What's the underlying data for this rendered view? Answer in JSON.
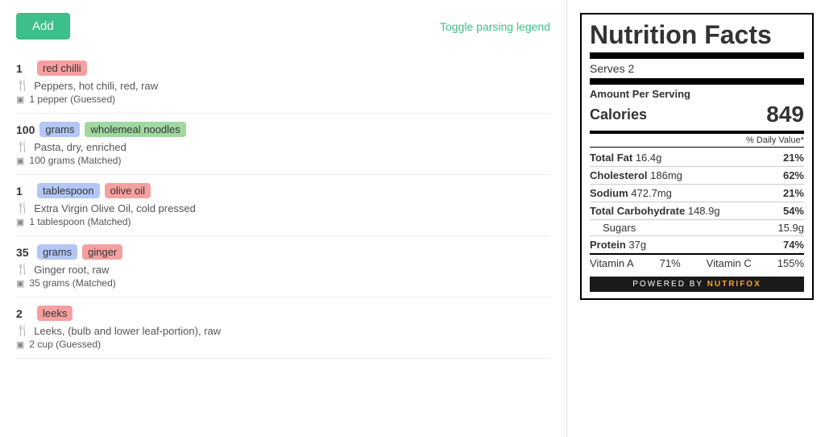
{
  "toolbar": {
    "add_label": "Add",
    "toggle_label": "Toggle parsing legend"
  },
  "ingredients": [
    {
      "qty": "1",
      "unit": null,
      "name": "red chilli",
      "name_color": "pink",
      "unit_color": null,
      "description": "Peppers, hot chili, red, raw",
      "match": "1 pepper (Guessed)"
    },
    {
      "qty": "100",
      "unit": "grams",
      "name": "wholemeal noodles",
      "name_color": "green",
      "unit_color": "blue",
      "description": "Pasta, dry, enriched",
      "match": "100 grams (Matched)"
    },
    {
      "qty": "1",
      "unit": "tablespoon",
      "name": "olive oil",
      "name_color": "pink",
      "unit_color": "blue",
      "description": "Extra Virgin Olive Oil, cold pressed",
      "match": "1 tablespoon (Matched)"
    },
    {
      "qty": "35",
      "unit": "grams",
      "name": "ginger",
      "name_color": "pink",
      "unit_color": "blue",
      "description": "Ginger root, raw",
      "match": "35 grams (Matched)"
    },
    {
      "qty": "2",
      "unit": null,
      "name": "leeks",
      "name_color": "pink",
      "unit_color": null,
      "description": "Leeks, (bulb and lower leaf-portion), raw",
      "match": "2 cup (Guessed)"
    }
  ],
  "nutrition": {
    "title": "Nutrition Facts",
    "serves": "Serves 2",
    "amount_label": "Amount Per Serving",
    "calories_label": "Calories",
    "calories_value": "849",
    "dv_header": "% Daily Value*",
    "total_fat_label": "Total Fat",
    "total_fat_value": "16.4g",
    "total_fat_dv": "21%",
    "cholesterol_label": "Cholesterol",
    "cholesterol_value": "186mg",
    "cholesterol_dv": "62%",
    "sodium_label": "Sodium",
    "sodium_value": "472.7mg",
    "sodium_dv": "21%",
    "total_carb_label": "Total Carbohydrate",
    "total_carb_value": "148.9g",
    "total_carb_dv": "54%",
    "sugars_label": "Sugars",
    "sugars_value": "15.9g",
    "protein_label": "Protein",
    "protein_value": "37g",
    "protein_dv": "74%",
    "vitamin_a_label": "Vitamin A",
    "vitamin_a_dv": "71%",
    "vitamin_c_label": "Vitamin C",
    "vitamin_c_dv": "155%",
    "powered_text": "POWERED BY",
    "brand_text": "NUTRIFOX"
  }
}
